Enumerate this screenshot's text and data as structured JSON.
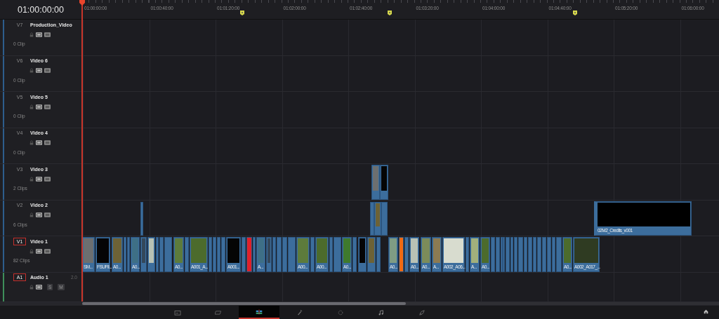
{
  "timecode": "01:00:00:00",
  "ruler": {
    "labels": [
      "01:00:00:00",
      "01:00:40:00",
      "01:01:20:00",
      "01:02:00:00",
      "01:02:40:00",
      "01:03:20:00",
      "01:04:00:00",
      "01:04:40:00",
      "01:05:20:00",
      "01:06:00:00"
    ]
  },
  "tracks": [
    {
      "kind": "video",
      "label": "V7",
      "name": "Production_Video",
      "count": "0 Clip",
      "selected": false
    },
    {
      "kind": "video",
      "label": "V6",
      "name": "Video 6",
      "count": "0 Clip",
      "selected": false
    },
    {
      "kind": "video",
      "label": "V5",
      "name": "Video 5",
      "count": "0 Clip",
      "selected": false
    },
    {
      "kind": "video",
      "label": "V4",
      "name": "Video 4",
      "count": "0 Clip",
      "selected": false
    },
    {
      "kind": "video",
      "label": "V3",
      "name": "Video 3",
      "count": "2 Clips",
      "selected": false,
      "clips": [
        {
          "kind": "thumb"
        },
        {
          "kind": "thumb"
        }
      ]
    },
    {
      "kind": "video",
      "label": "V2",
      "name": "Video 2",
      "count": "6 Clips",
      "selected": false,
      "clips": [
        {
          "kind": "bar"
        },
        {
          "kind": "bar"
        },
        {
          "kind": "thumb"
        },
        {
          "kind": "bar"
        },
        {
          "kind": "title",
          "label": "02M2_Credits_v001"
        }
      ]
    },
    {
      "kind": "video",
      "label": "V1",
      "name": "Video 1",
      "count": "82 Clips",
      "selected": true,
      "clips": [
        {
          "kind": "thumb",
          "label": "SM..."
        },
        {
          "kind": "thumb",
          "label": "FSUFIl..."
        },
        {
          "kind": "thumb",
          "label": "A0..."
        },
        {
          "kind": "bar"
        },
        {
          "kind": "bar"
        },
        {
          "kind": "thumb",
          "label": "A0..."
        },
        {
          "kind": "thumb"
        },
        {
          "kind": "thumb"
        },
        {
          "kind": "bar"
        },
        {
          "kind": "bar"
        },
        {
          "kind": "bar"
        },
        {
          "kind": "thumb",
          "label": "A0..."
        },
        {
          "kind": "bar"
        },
        {
          "kind": "thumb",
          "label": "A001_A..."
        },
        {
          "kind": "bar"
        },
        {
          "kind": "bar"
        },
        {
          "kind": "bar"
        },
        {
          "kind": "bar"
        },
        {
          "kind": "thumb",
          "label": "A001..."
        },
        {
          "kind": "bar"
        },
        {
          "kind": "red"
        },
        {
          "kind": "bar"
        },
        {
          "kind": "thumb",
          "label": "A..."
        },
        {
          "kind": "thumb"
        },
        {
          "kind": "bar"
        },
        {
          "kind": "bar"
        },
        {
          "kind": "bar"
        },
        {
          "kind": "bar"
        },
        {
          "kind": "thumb",
          "label": "A00..."
        },
        {
          "kind": "bar"
        },
        {
          "kind": "thumb",
          "label": "A00..."
        },
        {
          "kind": "bar"
        },
        {
          "kind": "bar"
        },
        {
          "kind": "thumb",
          "label": "A0..."
        },
        {
          "kind": "bar"
        },
        {
          "kind": "thumb"
        },
        {
          "kind": "thumb"
        },
        {
          "kind": "bar"
        },
        {
          "kind": "thumb",
          "label": "A0..."
        },
        {
          "kind": "orange"
        },
        {
          "kind": "bar"
        },
        {
          "kind": "thumb",
          "label": "A0..."
        },
        {
          "kind": "thumb",
          "label": "A0..."
        },
        {
          "kind": "thumb",
          "label": "A..."
        },
        {
          "kind": "thumb",
          "label": "A002_A06..."
        },
        {
          "kind": "bar"
        },
        {
          "kind": "thumb",
          "label": "A..."
        },
        {
          "kind": "thumb",
          "label": "A0..."
        },
        {
          "kind": "bar"
        },
        {
          "kind": "bar"
        },
        {
          "kind": "bar"
        },
        {
          "kind": "bar"
        },
        {
          "kind": "bar"
        },
        {
          "kind": "bar"
        },
        {
          "kind": "bar"
        },
        {
          "kind": "bar"
        },
        {
          "kind": "bar"
        },
        {
          "kind": "bar"
        },
        {
          "kind": "bar"
        },
        {
          "kind": "bar"
        },
        {
          "kind": "bar"
        },
        {
          "kind": "bar"
        },
        {
          "kind": "bar"
        },
        {
          "kind": "bar"
        },
        {
          "kind": "thumb",
          "label": "A0..."
        },
        {
          "kind": "thumb",
          "label": "A002_A017_..."
        }
      ]
    },
    {
      "kind": "audio",
      "label": "A1",
      "name": "Audio 1",
      "channels": "2.0",
      "selected": true,
      "solo": "S",
      "mute": "M"
    }
  ],
  "pages": [
    {
      "kind": "media",
      "selected": false
    },
    {
      "kind": "cut",
      "selected": false
    },
    {
      "kind": "edit",
      "selected": true
    },
    {
      "kind": "fusion",
      "selected": false
    },
    {
      "kind": "color",
      "selected": false
    },
    {
      "kind": "audio",
      "selected": false
    },
    {
      "kind": "deliver",
      "selected": false
    }
  ]
}
